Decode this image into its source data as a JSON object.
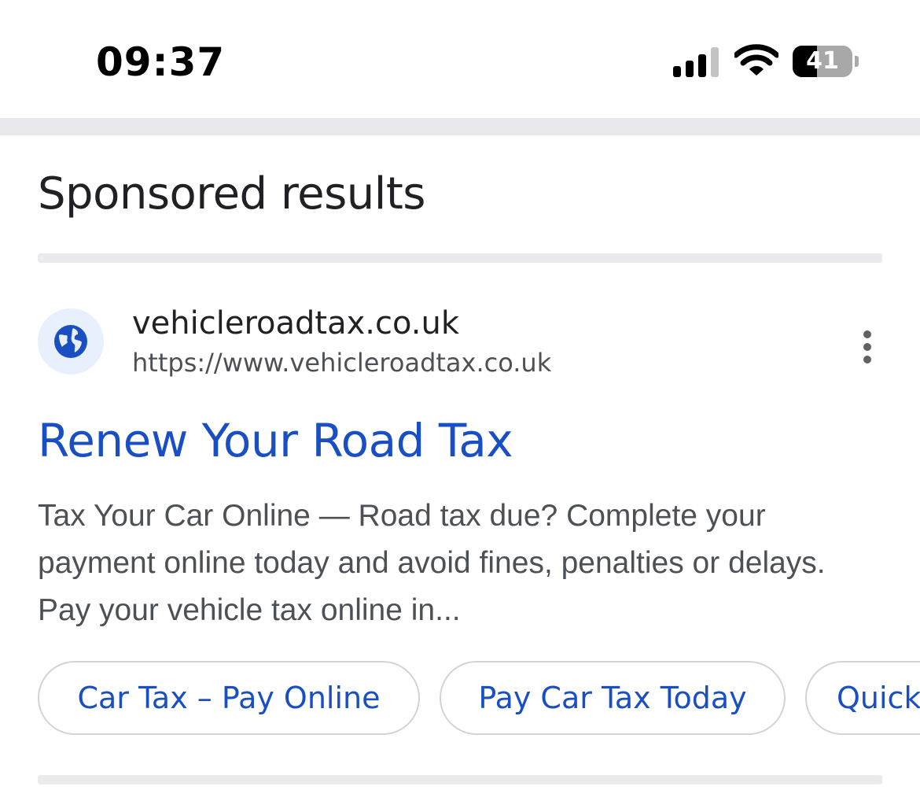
{
  "status_bar": {
    "time": "09:37",
    "battery_level": "41",
    "battery_fraction": 0.41
  },
  "section": {
    "title": "Sponsored results"
  },
  "ad": {
    "site_name": "vehicleroadtax.co.uk",
    "site_url": "https://www.vehicleroadtax.co.uk",
    "favicon": "globe-icon",
    "title": "Renew Your Road Tax",
    "description": "Tax Your Car Online — Road tax due? Complete your payment online today and avoid fines, penalties or delays. Pay your vehicle tax online in...",
    "sitelinks": [
      {
        "label": "Car Tax – Pay Online"
      },
      {
        "label": "Pay Car Tax Today"
      },
      {
        "label": "Quick"
      }
    ]
  },
  "colors": {
    "link_blue": "#1a4fc4",
    "text_dark": "#202124",
    "text_gray": "#4d5156",
    "favicon_bg": "#e8f0fe"
  }
}
